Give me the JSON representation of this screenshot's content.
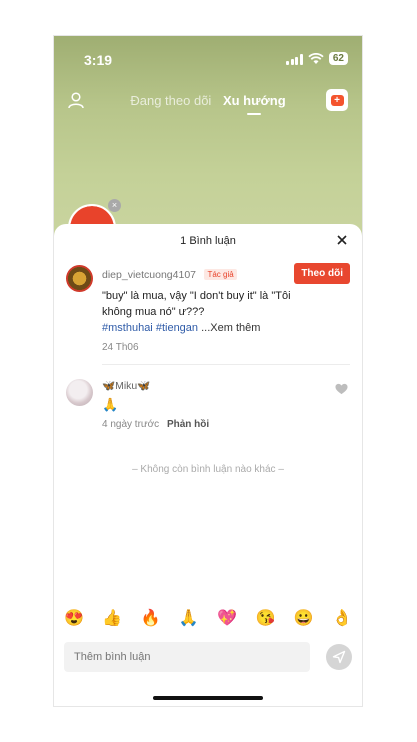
{
  "status_bar": {
    "time": "3:19",
    "battery": "62"
  },
  "top_nav": {
    "tabs": [
      {
        "label": "Đang theo dõi"
      },
      {
        "label": "Xu hướng"
      }
    ]
  },
  "comments_sheet": {
    "title": "1 Bình luận",
    "comments": [
      {
        "username": "diep_vietcuong4107",
        "author_tag": "Tác giả",
        "follow_label": "Theo dõi",
        "text": "\"buy\" là mua, vậy \"I don't buy it\" là \"Tôi không mua nó\" ư???",
        "hashtags": [
          "#msthuhai",
          "#tiengan"
        ],
        "see_more": "...Xem thêm",
        "date": "24 Th06"
      },
      {
        "username": "🦋Miku🦋",
        "text": "🙏",
        "time_ago": "4 ngày trước",
        "reply_label": "Phản hồi"
      }
    ],
    "end_text": "– Không còn bình luận nào khác –",
    "emoji_bar": [
      "😍",
      "👍",
      "🔥",
      "🙏",
      "💖",
      "😘",
      "😀",
      "👌"
    ],
    "input": {
      "placeholder": "Thêm bình luận"
    }
  },
  "colors": {
    "accent": "#e8472f",
    "hashtag": "#2f5ba8"
  },
  "icons": [
    "user-icon",
    "live-icon",
    "close-icon",
    "heart-icon",
    "send-icon",
    "signal-icon",
    "wifi-icon"
  ]
}
